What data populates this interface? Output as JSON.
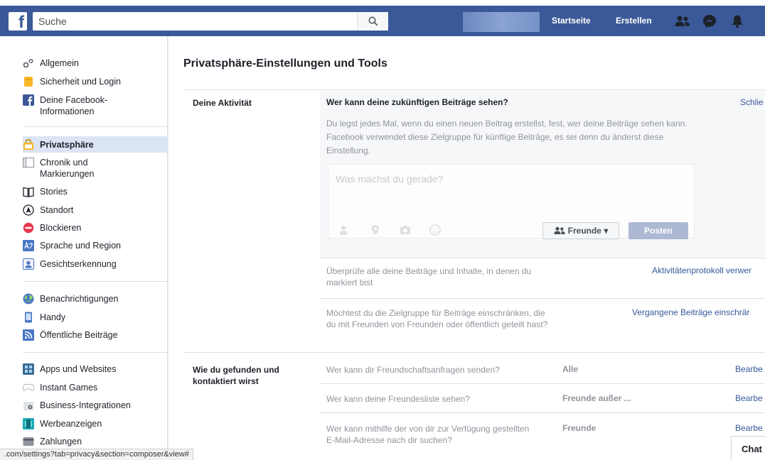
{
  "topbar": {
    "logo": "f",
    "search_placeholder": "Suche",
    "nav": [
      "Startseite",
      "Erstellen"
    ]
  },
  "sidebar": {
    "groups": [
      [
        {
          "label": "Allgemein",
          "icon": "gear-icon"
        },
        {
          "label": "Sicherheit und Login",
          "icon": "badge-icon"
        },
        {
          "label": "Deine Facebook-\nInformationen",
          "icon": "facebook-icon"
        }
      ],
      [
        {
          "label": "Privatsphäre",
          "icon": "lock-icon",
          "active": true
        },
        {
          "label": "Chronik und\nMarkierungen",
          "icon": "timeline-icon"
        },
        {
          "label": "Stories",
          "icon": "book-icon"
        },
        {
          "label": "Standort",
          "icon": "location-icon"
        },
        {
          "label": "Blockieren",
          "icon": "block-icon"
        },
        {
          "label": "Sprache und Region",
          "icon": "language-icon"
        },
        {
          "label": "Gesichtserkennung",
          "icon": "face-icon"
        }
      ],
      [
        {
          "label": "Benachrichtigungen",
          "icon": "globe-icon"
        },
        {
          "label": "Handy",
          "icon": "phone-icon"
        },
        {
          "label": "Öffentliche Beiträge",
          "icon": "rss-icon"
        }
      ],
      [
        {
          "label": "Apps und Websites",
          "icon": "apps-icon"
        },
        {
          "label": "Instant Games",
          "icon": "game-icon"
        },
        {
          "label": "Business-Integrationen",
          "icon": "business-icon"
        },
        {
          "label": "Werbeanzeigen",
          "icon": "ads-icon"
        },
        {
          "label": "Zahlungen",
          "icon": "payment-icon"
        }
      ]
    ]
  },
  "main": {
    "title": "Privatsphäre-Einstellungen und Tools",
    "activity": {
      "label": "Deine Aktivität",
      "question": "Wer kann deine zukünftigen Beiträge sehen?",
      "close_link": "Schlie",
      "description": "Du legst jedes Mal, wenn du einen neuen Beitrag erstellst, fest, wer deine Beiträge sehen kann. Facebook verwendet diese Zielgruppe für künftige Beiträge, es sei denn du änderst diese Einstellung.",
      "composer_placeholder": "Was machst du gerade?",
      "audience_label": "Freunde ▾",
      "post_label": "Posten",
      "review": "Überprüfe alle deine Beiträge und Inhalte, in denen du markiert bist",
      "review_link": "Aktivitätenprotokoll verwer",
      "limit": "Möchtest du die Zielgruppe für Beiträge einschränken, die du mit Freunden von Freunden oder öffentlich geteilt hast?",
      "limit_link": "Vergangene Beiträge einschrär"
    },
    "find": {
      "label": "Wie du gefunden und kontaktiert wirst",
      "rows": [
        {
          "q": "Wer kann dir Freundschaftsanfragen senden?",
          "val": "Alle",
          "link": "Bearbe"
        },
        {
          "q": "Wer kann deine Freundesliste sehen?",
          "val": "Freunde außer ...",
          "link": "Bearbe"
        },
        {
          "q": "Wer kann mithilfe der von dir zur Verfügung gestellten E-Mail-Adresse nach dir suchen?",
          "val": "Freunde",
          "link": "Bearbe"
        }
      ]
    }
  },
  "status_url": ".com/settings?tab=privacy&section=composer&view#",
  "chat_label": "Chat"
}
